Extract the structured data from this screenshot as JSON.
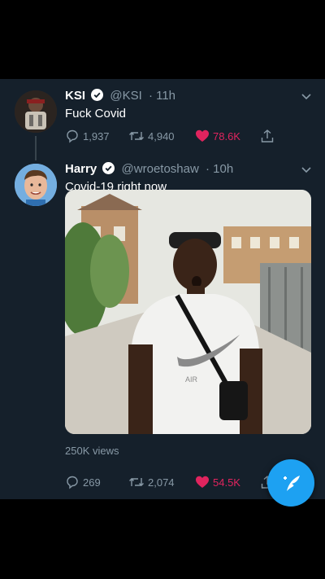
{
  "colors": {
    "background": "#15202b",
    "accent": "#1da1f2",
    "like": "#e0245e",
    "muted": "#8899a6"
  },
  "tweets": [
    {
      "name": "KSI",
      "handle": "@KSI",
      "time": "· 11h",
      "text": "Fuck Covid",
      "replies": "1,937",
      "retweets": "4,940",
      "likes": "78.6K",
      "liked": true
    },
    {
      "name": "Harry",
      "handle": "@wroetoshaw",
      "time": "· 10h",
      "text": "Covid-19 right now",
      "views": "250K views",
      "replies": "269",
      "retweets": "2,074",
      "likes": "54.5K",
      "liked": true,
      "media": {
        "shirt_text": "AIR"
      }
    }
  ],
  "icons": {
    "verified": "verified-badge-icon",
    "reply": "reply-icon",
    "retweet": "retweet-icon",
    "like": "heart-icon",
    "share": "share-icon",
    "more": "chevron-down-icon",
    "compose": "compose-tweet-icon"
  }
}
